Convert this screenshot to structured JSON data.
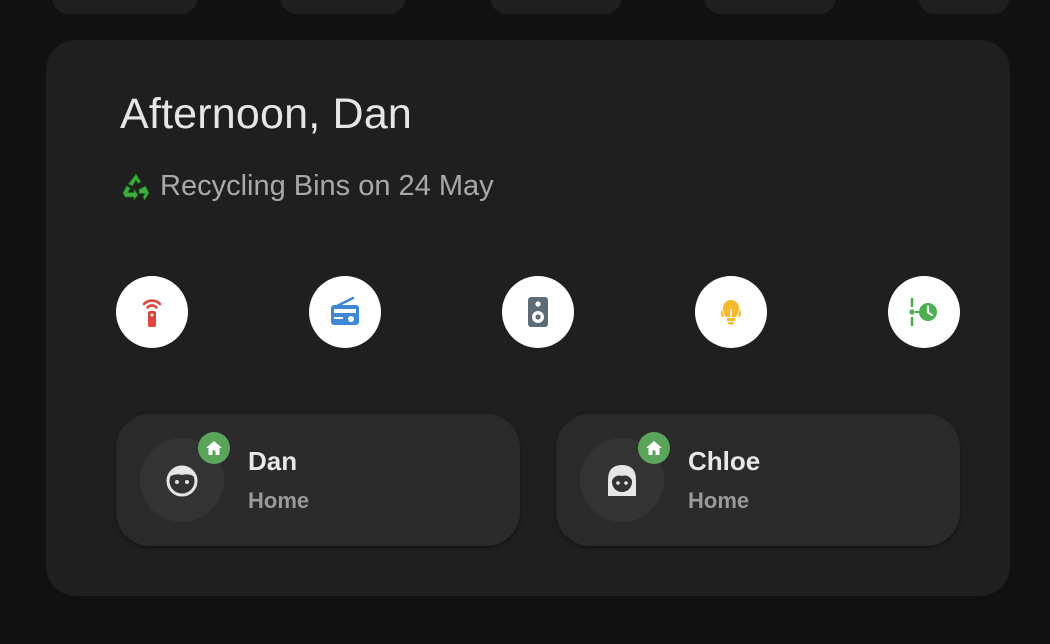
{
  "greeting": "Afternoon, Dan",
  "subtitle": {
    "icon": "recycle-icon",
    "text": "Recycling Bins on 24 May"
  },
  "actions": [
    {
      "icon": "remote-icon",
      "color": "#e0443a"
    },
    {
      "icon": "radio-icon",
      "color": "#3f88d8"
    },
    {
      "icon": "speaker-icon",
      "color": "#5b6b78"
    },
    {
      "icon": "lights-icon",
      "color": "#f4b92c"
    },
    {
      "icon": "timeline-clock-icon",
      "color": "#4caf50"
    }
  ],
  "people": [
    {
      "name": "Dan",
      "state": "Home",
      "avatar": "boy-face-icon",
      "badge": "home-icon"
    },
    {
      "name": "Chloe",
      "state": "Home",
      "avatar": "girl-face-icon",
      "badge": "home-icon"
    }
  ],
  "colors": {
    "background": "#111111",
    "card": "#1f1f1f",
    "person_card": "#2a2a2a",
    "badge": "#5aa55a"
  }
}
